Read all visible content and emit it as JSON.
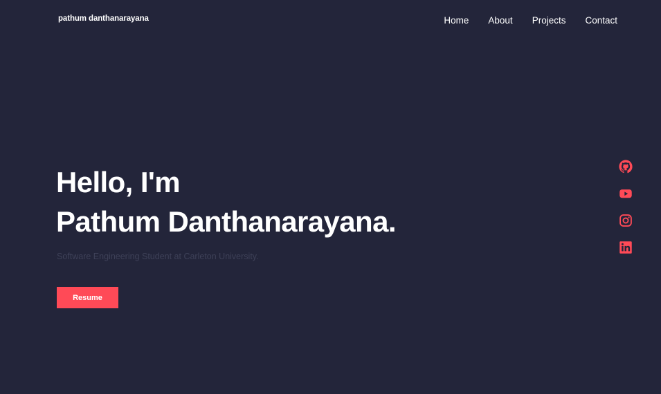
{
  "header": {
    "logo": "pathum danthanarayana",
    "nav": [
      "Home",
      "About",
      "Projects",
      "Contact"
    ]
  },
  "hero": {
    "greeting": "Hello, I'm",
    "name": "Pathum Danthanarayana.",
    "subtitle": "Software Engineering Student at Carleton University.",
    "resume_label": "Resume"
  },
  "social": {
    "icons": [
      "github-icon",
      "youtube-icon",
      "instagram-icon",
      "linkedin-icon"
    ]
  },
  "colors": {
    "background": "#23253a",
    "accent": "#ff4a57",
    "text": "#ffffff",
    "muted": "#3e4158"
  }
}
